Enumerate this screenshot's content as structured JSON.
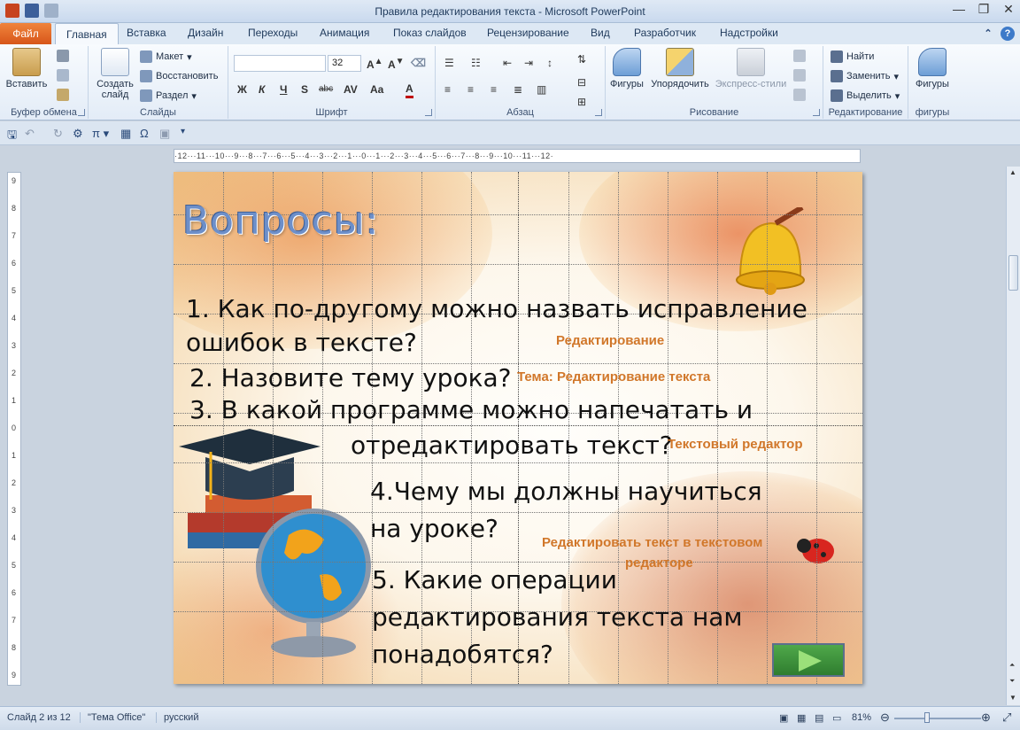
{
  "window": {
    "title": "Правила редактирования текста - Microsoft PowerPoint"
  },
  "tabs": [
    "Файл",
    "Главная",
    "Вставка",
    "Дизайн",
    "Переходы",
    "Анимация",
    "Показ слайдов",
    "Рецензирование",
    "Вид",
    "Разработчик",
    "Надстройки"
  ],
  "ribbon": {
    "clipboard": {
      "paste": "Вставить",
      "label": "Буфер обмена"
    },
    "slides": {
      "new_slide": "Создать слайд",
      "layout": "Макет",
      "reset": "Восстановить",
      "section": "Раздел",
      "label": "Слайды"
    },
    "font": {
      "name": "",
      "size": "32",
      "label": "Шрифт",
      "bold": "Ж",
      "italic": "К",
      "underline": "Ч",
      "shadow": "S",
      "strike": "abc"
    },
    "paragraph": {
      "label": "Абзац"
    },
    "drawing": {
      "shapes": "Фигуры",
      "arrange": "Упорядочить",
      "quick_styles": "Экспресс-стили",
      "label": "Рисование"
    },
    "editing": {
      "find": "Найти",
      "replace": "Заменить",
      "select": "Выделить",
      "label": "Редактирование"
    },
    "figures": {
      "shapes": "Фигуры",
      "label": "фигуры"
    }
  },
  "ruler": {
    "horizontal": "·12···11···10···9···8···7···6···5···4···3···2···1···0···1···2···3···4···5···6···7···8···9···10···11···12·",
    "vertical": [
      "9",
      "8",
      "7",
      "6",
      "5",
      "4",
      "3",
      "2",
      "1",
      "0",
      "1",
      "2",
      "3",
      "4",
      "5",
      "6",
      "7",
      "8",
      "9"
    ]
  },
  "slide": {
    "title": "Вопросы:",
    "q1_line1": "1. Как по-другому можно назвать исправление",
    "q1_line2": "ошибок в тексте?",
    "a1": "Редактирование",
    "q2": "2. Назовите тему урока?",
    "a2": "Тема: Редактирование  текста",
    "q3_line1": "3. В какой программе можно напечатать и",
    "q3_line2": "отредактировать текст?",
    "a3": "Текстовый редактор",
    "q4_line1": "4.Чему мы должны научиться",
    "q4_line2": "на уроке?",
    "a4_line1": "Редактировать текст в текстовом",
    "a4_line2": "редакторе",
    "q5_line1": "5. Какие операции",
    "q5_line2": "редактирования текста нам",
    "q5_line3": "понадобятся?"
  },
  "status": {
    "slide_info": "Слайд 2 из 12",
    "theme": "\"Тема Office\"",
    "language": "русский",
    "zoom": "81%"
  }
}
